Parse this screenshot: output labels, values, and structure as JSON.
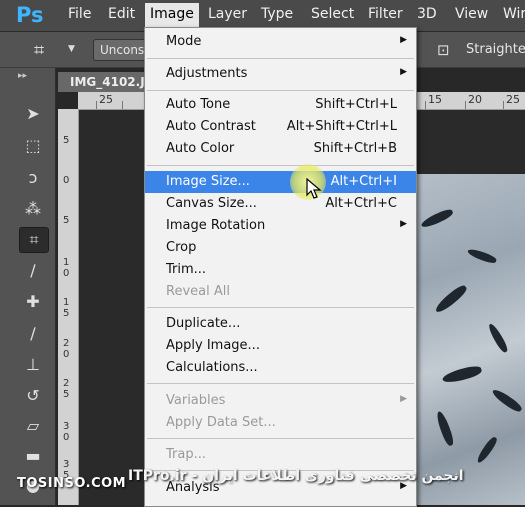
{
  "app": {
    "logo": "Ps"
  },
  "menubar": {
    "file": "File",
    "edit": "Edit",
    "image": "Image",
    "layer": "Layer",
    "type": "Type",
    "select": "Select",
    "filter": "Filter",
    "three_d": "3D",
    "view": "View",
    "window": "Wir"
  },
  "options_bar": {
    "field_value": "Unconstr",
    "straighten_label": "Straighten"
  },
  "document": {
    "tab_title": "IMG_4102.J",
    "ruler_h": [
      "25",
      "20",
      "15",
      "20",
      "25"
    ],
    "ruler_v": [
      "5",
      "0",
      "5",
      "1",
      "0",
      "1",
      "5",
      "2",
      "0",
      "2",
      "5",
      "3",
      "0",
      "3",
      "5"
    ]
  },
  "image_menu": {
    "mode": "Mode",
    "adjustments": "Adjustments",
    "auto_tone": "Auto Tone",
    "auto_tone_sc": "Shift+Ctrl+L",
    "auto_contrast": "Auto Contrast",
    "auto_contrast_sc": "Alt+Shift+Ctrl+L",
    "auto_color": "Auto Color",
    "auto_color_sc": "Shift+Ctrl+B",
    "image_size": "Image Size...",
    "image_size_sc": "Alt+Ctrl+I",
    "canvas_size": "Canvas Size...",
    "canvas_size_sc": "Alt+Ctrl+C",
    "image_rotation": "Image Rotation",
    "crop": "Crop",
    "trim": "Trim...",
    "reveal_all": "Reveal All",
    "duplicate": "Duplicate...",
    "apply_image": "Apply Image...",
    "calculations": "Calculations...",
    "variables": "Variables",
    "apply_data_set": "Apply Data Set...",
    "trap": "Trap...",
    "analysis": "Analysis"
  },
  "watermark": {
    "site": "TOSINSO.COM",
    "text": "ITPro.ir - انجمن تخصصی فناوری اطلاعات ایران"
  },
  "colors": {
    "highlight": "#3b85e8",
    "menu_bg": "#f2f2f2",
    "ps_blue": "#3fb5ff"
  }
}
